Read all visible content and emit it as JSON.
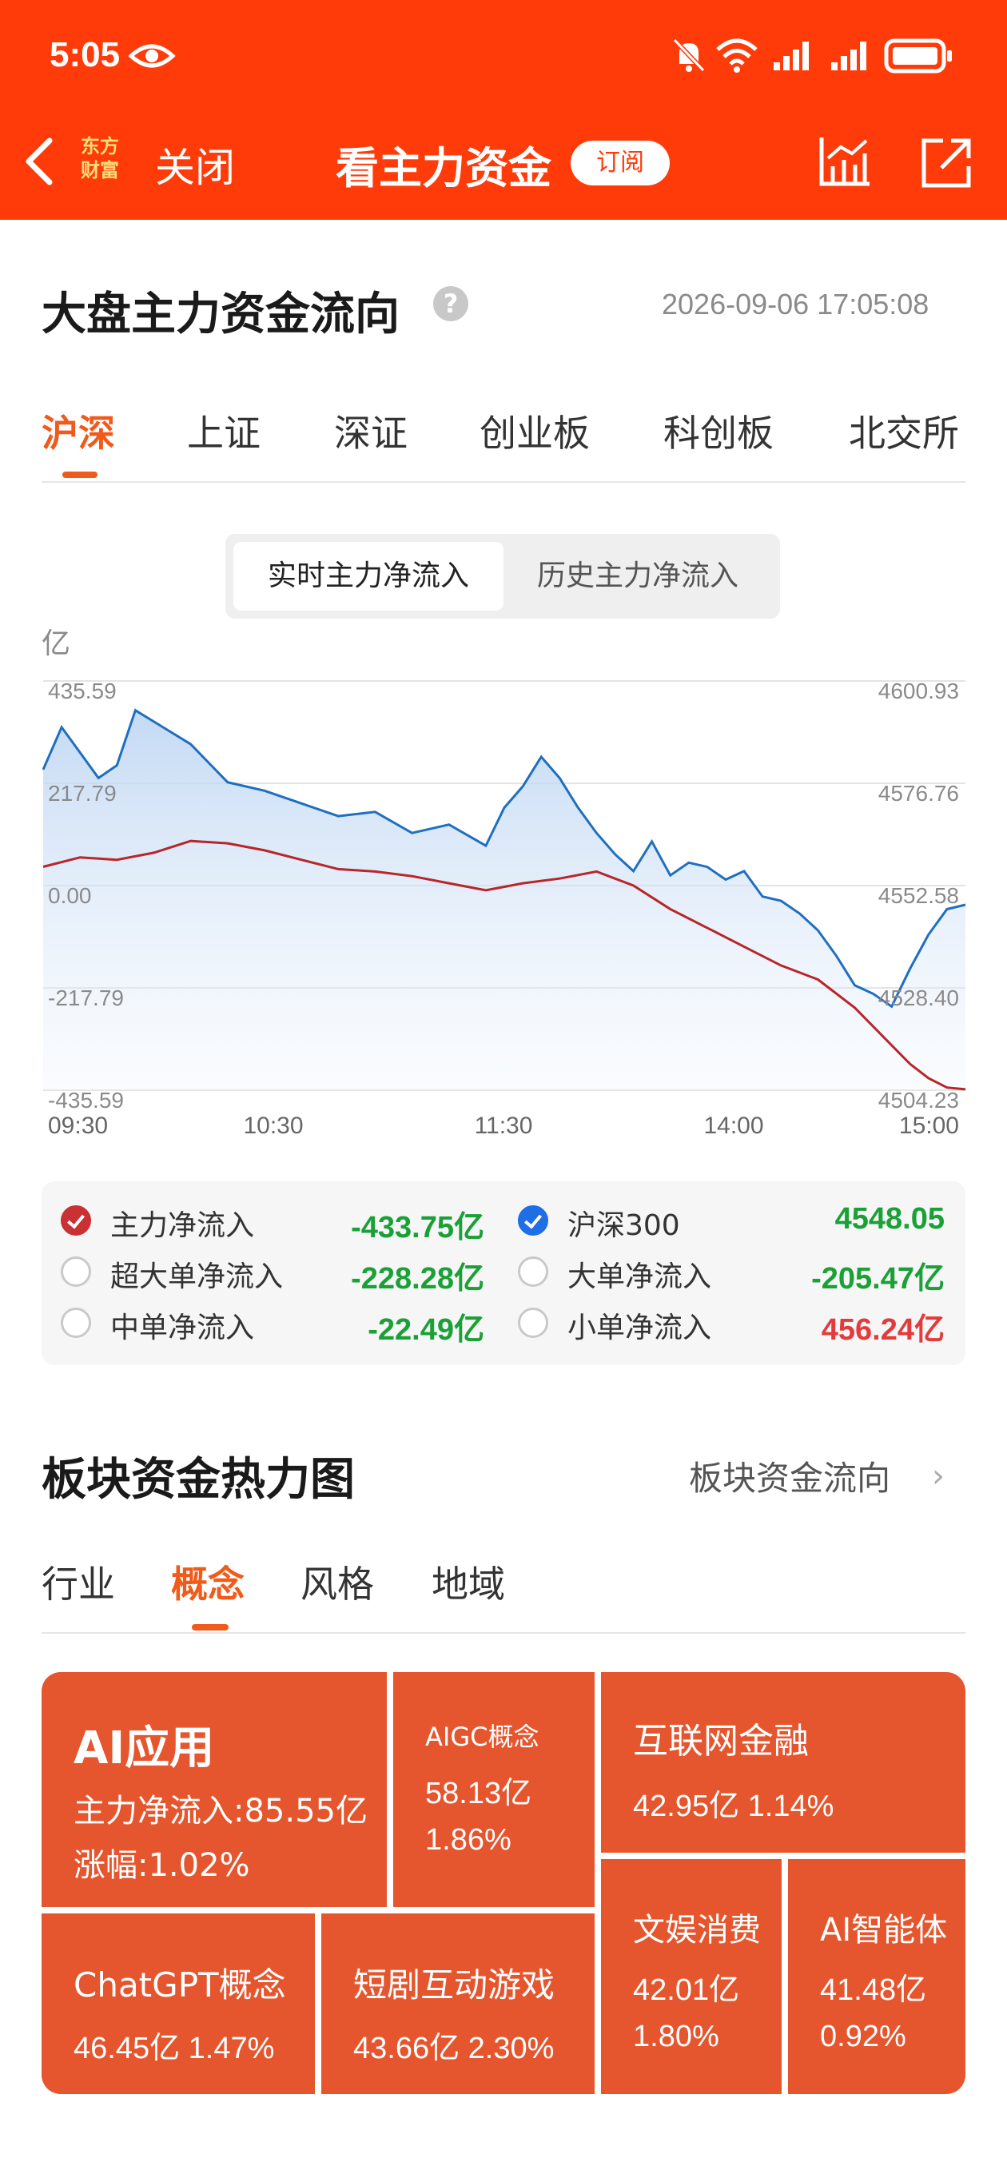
{
  "status_bar": {
    "time": "5:05"
  },
  "nav": {
    "logo_line1": "东方",
    "logo_line2": "财富",
    "close_label": "关闭",
    "title": "看主力资金",
    "subscribe_label": "订阅"
  },
  "flow": {
    "title": "大盘主力资金流向",
    "help": "?",
    "timestamp": "2026-09-06 17:05:08",
    "tabs": [
      "沪深",
      "上证",
      "深证",
      "创业板",
      "科创板",
      "北交所"
    ],
    "active_tab": 0,
    "segments": [
      "实时主力净流入",
      "历史主力净流入"
    ],
    "active_segment": 0
  },
  "chart_data": {
    "type": "line",
    "title": "",
    "xlabel": "",
    "ylabel": "亿",
    "x_ticks": [
      "09:30",
      "10:30",
      "11:30",
      "14:00",
      "15:00"
    ],
    "left_axis_ticks": [
      "435.59",
      "217.79",
      "0.00",
      "-217.79",
      "-435.59"
    ],
    "right_axis_ticks": [
      "4600.93",
      "4576.76",
      "4552.58",
      "4528.40",
      "4504.23"
    ],
    "ylim_left": [
      -435.59,
      435.59
    ],
    "ylim_right": [
      4504.23,
      4600.93
    ],
    "grid": true,
    "series": [
      {
        "name": "主力净流入",
        "axis": "left",
        "color": "#b8262a",
        "x": [
          0,
          0.04,
          0.08,
          0.12,
          0.16,
          0.2,
          0.24,
          0.28,
          0.32,
          0.36,
          0.4,
          0.44,
          0.48,
          0.52,
          0.56,
          0.6,
          0.64,
          0.68,
          0.72,
          0.76,
          0.8,
          0.84,
          0.88,
          0.9,
          0.92,
          0.94,
          0.96,
          0.98,
          1.0
        ],
        "values": [
          40,
          60,
          55,
          70,
          95,
          90,
          75,
          55,
          35,
          30,
          20,
          5,
          -10,
          5,
          15,
          30,
          0,
          -50,
          -90,
          -130,
          -170,
          -200,
          -260,
          -300,
          -340,
          -380,
          -410,
          -430,
          -433.75
        ]
      },
      {
        "name": "沪深300",
        "axis": "right",
        "color": "#1f6fc0",
        "x": [
          0,
          0.02,
          0.04,
          0.06,
          0.08,
          0.1,
          0.13,
          0.16,
          0.2,
          0.24,
          0.28,
          0.32,
          0.36,
          0.4,
          0.44,
          0.48,
          0.5,
          0.52,
          0.54,
          0.56,
          0.58,
          0.6,
          0.62,
          0.64,
          0.66,
          0.68,
          0.7,
          0.72,
          0.74,
          0.76,
          0.78,
          0.8,
          0.82,
          0.84,
          0.86,
          0.88,
          0.9,
          0.92,
          0.94,
          0.96,
          0.98,
          1.0
        ],
        "values": [
          4580,
          4590,
          4584,
          4578,
          4581,
          4594,
          4590,
          4586,
          4577,
          4575,
          4572,
          4569,
          4570,
          4565,
          4567,
          4562,
          4571,
          4576,
          4583,
          4578,
          4571,
          4565,
          4560,
          4556,
          4563,
          4555,
          4558,
          4557,
          4554,
          4556,
          4550,
          4549,
          4546,
          4542,
          4536,
          4529,
          4527,
          4524,
          4533,
          4541,
          4547,
          4548.05
        ]
      }
    ]
  },
  "legend": [
    {
      "label": "主力净流入",
      "value": "-433.75亿",
      "state": "red",
      "value_color": "green"
    },
    {
      "label": "沪深300",
      "value": "4548.05",
      "state": "blue",
      "value_color": "green"
    },
    {
      "label": "超大单净流入",
      "value": "-228.28亿",
      "state": "off",
      "value_color": "green"
    },
    {
      "label": "大单净流入",
      "value": "-205.47亿",
      "state": "off",
      "value_color": "green"
    },
    {
      "label": "中单净流入",
      "value": "-22.49亿",
      "state": "off",
      "value_color": "green"
    },
    {
      "label": "小单净流入",
      "value": "456.24亿",
      "state": "off",
      "value_color": "red"
    }
  ],
  "heatmap": {
    "title": "板块资金热力图",
    "link": "板块资金流向",
    "tabs": [
      "行业",
      "概念",
      "风格",
      "地域"
    ],
    "active_tab": 1,
    "tiles": [
      {
        "name": "AI应用",
        "line1": "主力净流入:85.55亿",
        "line2": "涨幅:1.02%"
      },
      {
        "name": "AIGC概念",
        "line1": "58.13亿",
        "line2": "1.86%"
      },
      {
        "name": "互联网金融",
        "line1": "42.95亿  1.14%"
      },
      {
        "name": "ChatGPT概念",
        "line1": "46.45亿  1.47%"
      },
      {
        "name": "短剧互动游戏",
        "line1": "43.66亿  2.30%"
      },
      {
        "name": "文娱消费",
        "line1": "42.01亿",
        "line2": "1.80%"
      },
      {
        "name": "AI智能体",
        "line1": "41.48亿",
        "line2": "0.92%"
      }
    ]
  }
}
